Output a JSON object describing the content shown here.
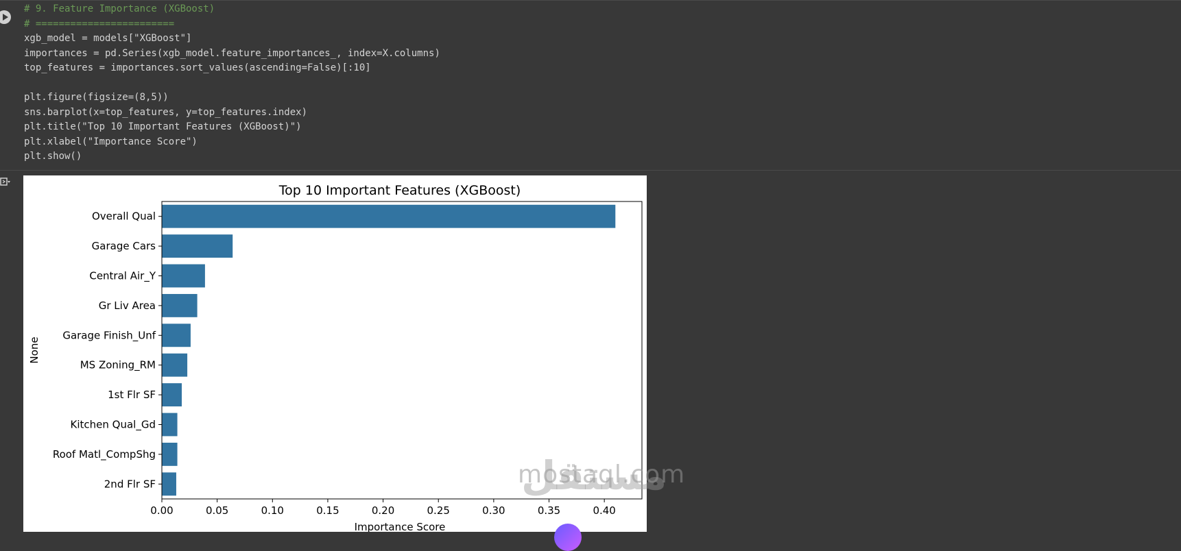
{
  "code_lines": [
    "# 9. Feature Importance (XGBoost)",
    "# ========================",
    "xgb_model = models[\"XGBoost\"]",
    "importances = pd.Series(xgb_model.feature_importances_, index=X.columns)",
    "top_features = importances.sort_values(ascending=False)[:10]",
    "",
    "plt.figure(figsize=(8,5))",
    "sns.barplot(x=top_features, y=top_features.index)",
    "plt.title(\"Top 10 Important Features (XGBoost)\")",
    "plt.xlabel(\"Importance Score\")",
    "plt.show()"
  ],
  "watermark": {
    "latin": "mostaql.com",
    "arabic": "مستقل"
  },
  "colors": {
    "bar": "#3274a1",
    "editor_bg": "#383838"
  },
  "chart_data": {
    "type": "bar",
    "orientation": "horizontal",
    "title": "Top 10 Important Features (XGBoost)",
    "xlabel": "Importance Score",
    "ylabel": "None",
    "categories": [
      "Overall Qual",
      "Garage Cars",
      "Central Air_Y",
      "Gr Liv Area",
      "Garage Finish_Unf",
      "MS Zoning_RM",
      "1st Flr SF",
      "Kitchen Qual_Gd",
      "Roof Matl_CompShg",
      "2nd Flr SF"
    ],
    "values": [
      0.41,
      0.064,
      0.039,
      0.032,
      0.026,
      0.023,
      0.018,
      0.014,
      0.014,
      0.013
    ],
    "xlim": [
      0,
      0.434
    ],
    "xticks": [
      "0.00",
      "0.05",
      "0.10",
      "0.15",
      "0.20",
      "0.25",
      "0.30",
      "0.35",
      "0.40"
    ],
    "grid": false
  }
}
